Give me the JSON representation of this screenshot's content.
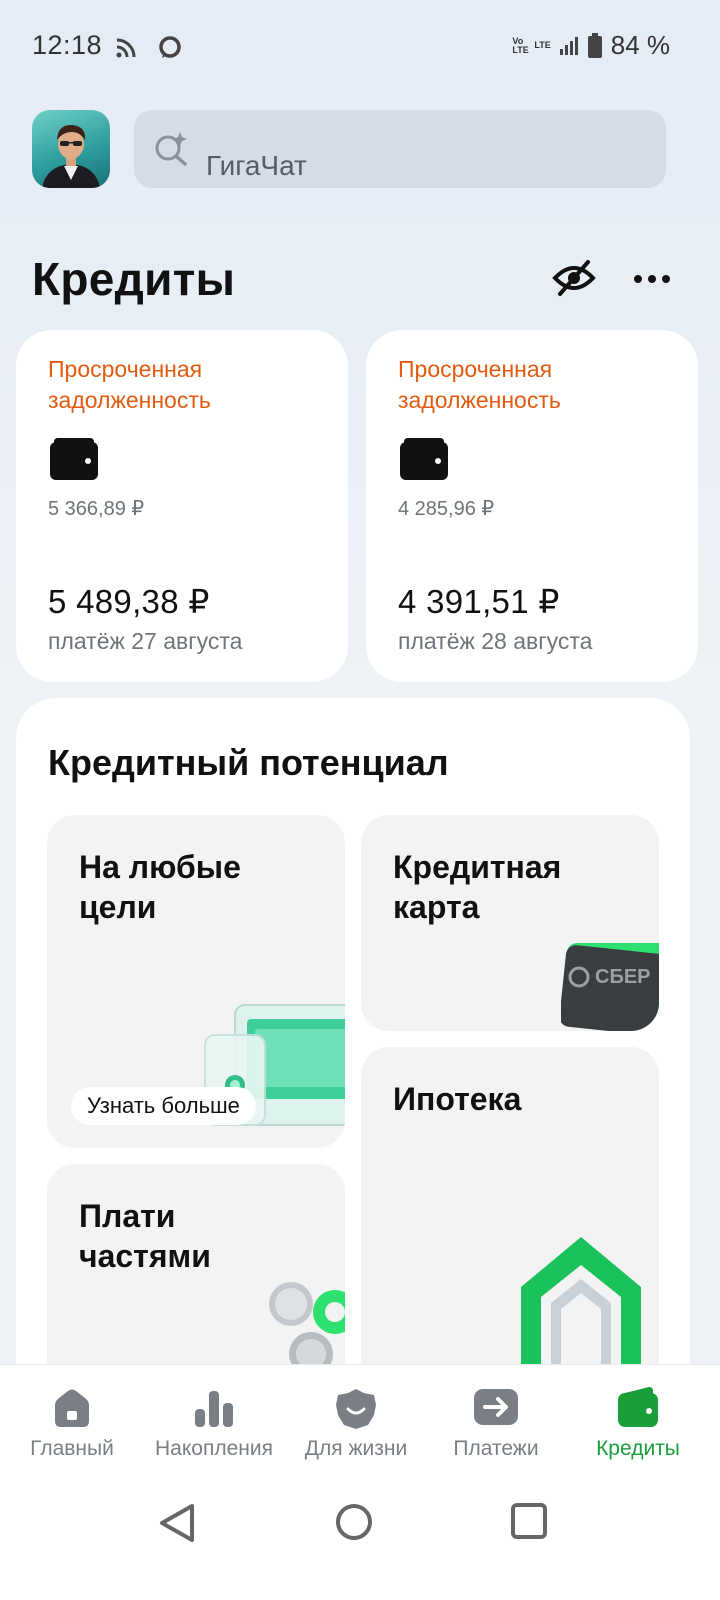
{
  "status_bar": {
    "time": "12:18",
    "volte": "Vo LTE",
    "lte": "LTE",
    "battery": "84 %"
  },
  "header": {
    "search_placeholder": "ГигаЧат",
    "title": "Кредиты"
  },
  "debt_cards": [
    {
      "label": "Просроченная задолженность",
      "overdue": "5 366,89 ₽",
      "amount": "5 489,38 ₽",
      "date": "платёж 27 августа"
    },
    {
      "label": "Просроченная задолженность",
      "overdue": "4 285,96 ₽",
      "amount": "4 391,51 ₽",
      "date": "платёж 28 августа"
    }
  ],
  "potential": {
    "title": "Кредитный потенциал",
    "tiles": [
      {
        "title": "На любые цели",
        "button": "Узнать больше"
      },
      {
        "title": "Кредитная карта",
        "card_text": "СБЕР"
      },
      {
        "title": "Ипотека"
      },
      {
        "title": "Плати частями"
      }
    ]
  },
  "bottom_nav": [
    {
      "label": "Главный",
      "icon": "home-icon"
    },
    {
      "label": "Накопления",
      "icon": "bar-chart-icon"
    },
    {
      "label": "Для жизни",
      "icon": "smile-badge-icon"
    },
    {
      "label": "Платежи",
      "icon": "arrow-right-icon"
    },
    {
      "label": "Кредиты",
      "icon": "wallet-icon",
      "active": true
    }
  ],
  "colors": {
    "accent_green": "#1a9e3a",
    "overdue_orange": "#e35b0e",
    "nav_gray": "#7a7f85"
  }
}
